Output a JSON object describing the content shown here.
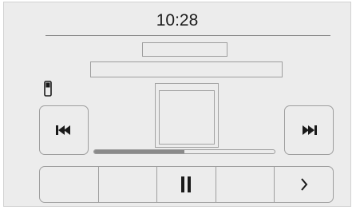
{
  "status": {
    "time": "10:28"
  },
  "now_playing": {
    "title": "",
    "artist": "",
    "progress_fraction": 0.5
  },
  "icons": {
    "source": "phone-icon",
    "previous": "skip-previous-icon",
    "next": "skip-next-icon",
    "pause": "pause-icon",
    "more": "chevron-right-icon"
  },
  "colors": {
    "background": "#ececec",
    "outline": "#9e9e9e",
    "progress_fill": "#8a8a8a",
    "icon": "#1a1a1a"
  }
}
